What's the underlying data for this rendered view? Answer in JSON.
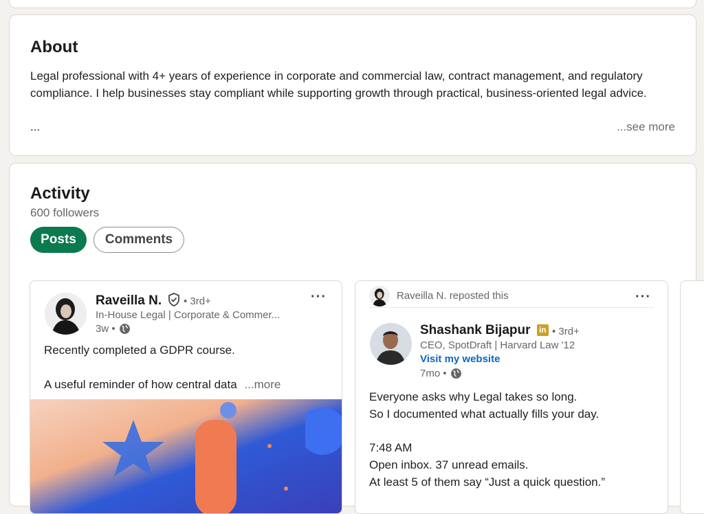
{
  "about": {
    "title": "About",
    "text": "Legal professional with 4+ years of experience in corporate and commercial law, contract management, and regulatory compliance. I help businesses stay compliant while supporting growth through practical, business-oriented legal advice.",
    "ellipsis": "...",
    "see_more": "...see more"
  },
  "activity": {
    "title": "Activity",
    "followers": "600 followers",
    "tabs": [
      {
        "label": "Posts",
        "active": true
      },
      {
        "label": "Comments",
        "active": false
      }
    ]
  },
  "posts": [
    {
      "author": "Raveilla N.",
      "degree": "• 3rd+",
      "headline": "In-House Legal | Corporate & Commer...",
      "time": "3w •",
      "text_line1": "Recently completed a GDPR course.",
      "text_line2": "A useful reminder of how central data",
      "more": "...more",
      "menu": "···"
    },
    {
      "repost_text": "Raveilla N. reposted this",
      "author": "Shashank Bijapur",
      "badge": "in",
      "degree": "• 3rd+",
      "headline": "CEO, SpotDraft | Harvard Law '12",
      "link": "Visit my website",
      "time": "7mo •",
      "lines": [
        "Everyone asks why Legal takes so long.",
        "So I documented what actually fills your day.",
        "7:48 AM",
        "Open inbox. 37 unread emails.",
        "At least 5 of them say “Just a quick question.”"
      ],
      "menu": "···"
    }
  ],
  "colors": {
    "accent": "#0b7a4f",
    "link": "#0a66c2",
    "badge": "#c9a227",
    "page_bg": "#f4f2ee"
  },
  "icons": [
    "verified-shield-icon",
    "globe-icon",
    "more-options-icon",
    "linkedin-badge-icon"
  ]
}
